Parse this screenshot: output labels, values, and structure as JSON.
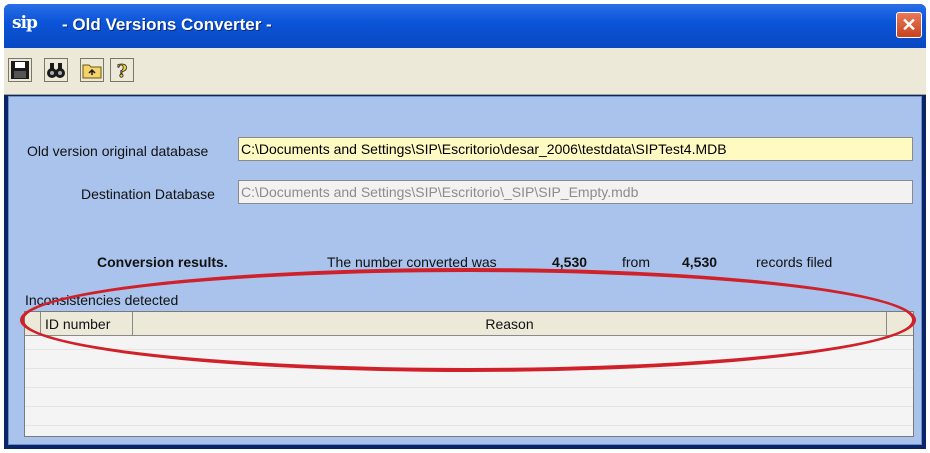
{
  "window": {
    "icon_text": "sip",
    "title": "- Old Versions Converter -",
    "close_glyph": "✕"
  },
  "toolbar": {
    "buttons": [
      "save-icon",
      "binoculars-icon",
      "folder-up-icon",
      "help-icon"
    ]
  },
  "form": {
    "original_db_label": "Old version original database",
    "original_db_value": "C:\\Documents and Settings\\SIP\\Escritorio\\desar_2006\\testdata\\SIPTest4.MDB",
    "destination_db_label": "Destination Database",
    "destination_db_value": "C:\\Documents and Settings\\SIP\\Escritorio\\_SIP\\SIP_Empty.mdb"
  },
  "results": {
    "heading": "Conversion results.",
    "converted_text": "The number converted was",
    "converted_count": "4,530",
    "from_text": "from",
    "total_count": "4,530",
    "records_text": "records filed"
  },
  "inconsistencies": {
    "label": "Inconsistencies detected",
    "columns": [
      "ID number",
      "Reason"
    ]
  },
  "colors": {
    "titlebar": "#0b55d9",
    "panel": "#a9c3ec",
    "active_field": "#fffac2",
    "annotation": "#d0202a"
  }
}
